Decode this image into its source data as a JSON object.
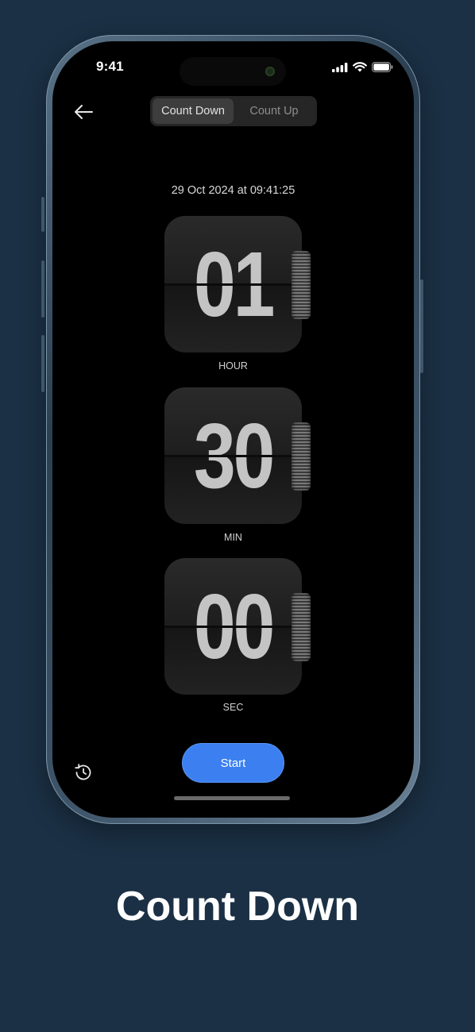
{
  "status_bar": {
    "time": "9:41"
  },
  "segmented": {
    "count_down": "Count Down",
    "count_up": "Count Up",
    "selected": "count_down"
  },
  "datetime": "29 Oct 2024 at 09:41:25",
  "timer": {
    "hours": {
      "value": "01",
      "label": "HOUR"
    },
    "minutes": {
      "value": "30",
      "label": "MIN"
    },
    "seconds": {
      "value": "00",
      "label": "SEC"
    }
  },
  "start_label": "Start",
  "icons": {
    "back": "arrow-left-icon",
    "history": "history-icon",
    "signal": "cellular-signal-icon",
    "wifi": "wifi-icon",
    "battery": "battery-icon"
  },
  "colors": {
    "background": "#1b3044",
    "accent": "#3c7ff0"
  },
  "caption": "Count Down"
}
